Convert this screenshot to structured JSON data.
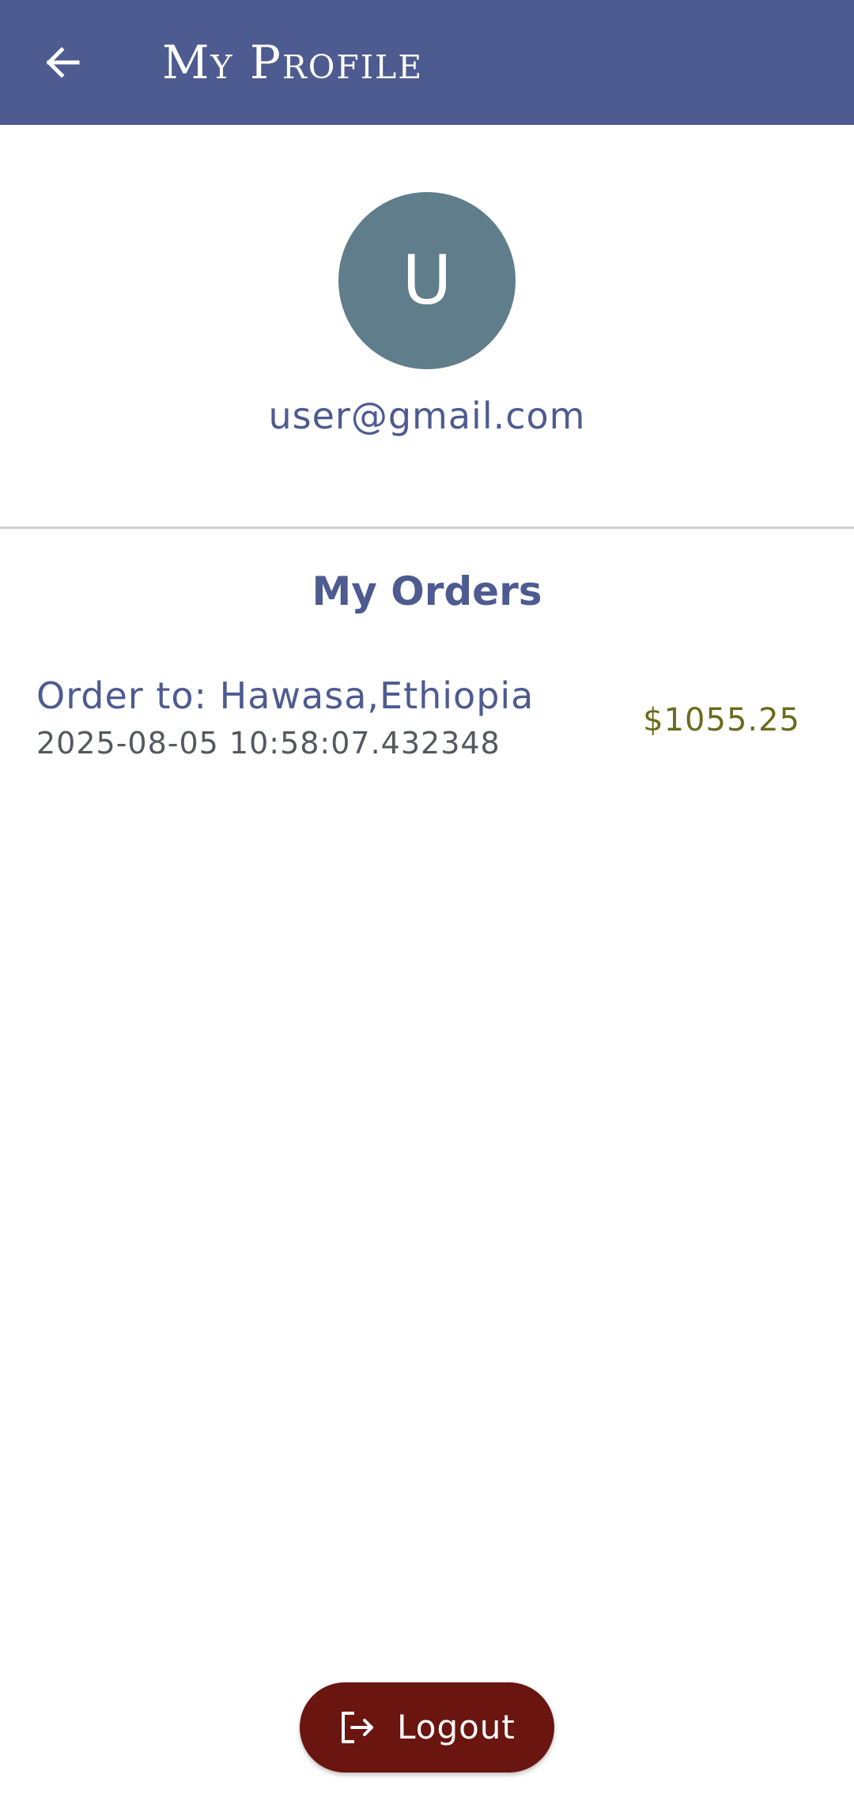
{
  "appbar": {
    "title": "My Profile",
    "back_icon": "arrow-left-icon",
    "color": "#4d5b91"
  },
  "profile": {
    "avatar_letter": "U",
    "avatar_color": "#607d8b",
    "email": "user@gmail.com"
  },
  "orders": {
    "title": "My Orders",
    "items": [
      {
        "destination": "Order to: Hawasa,Ethiopia",
        "datetime": "2025-08-05 10:58:07.432348",
        "price": "$1055.25"
      }
    ]
  },
  "logout": {
    "label": "Logout",
    "icon": "logout-icon",
    "color": "#6b1510"
  }
}
